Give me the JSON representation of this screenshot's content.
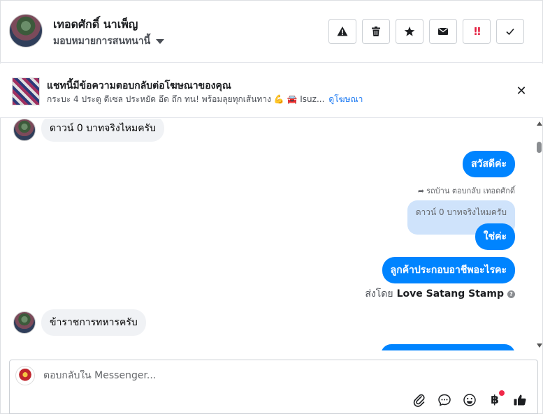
{
  "header": {
    "user_name": "เทอดศักดิ์ นาเพ็ญ",
    "assign_label": "มอบหมายการสนทนานี้"
  },
  "ad_banner": {
    "title": "แชทนี้มีข้อความตอบกลับต่อโฆษณาของคุณ",
    "subtitle": "กระบะ 4 ประตู ดีเซล ประหยัด อึด ถึก ทน! พร้อมลุยทุกเส้นทาง 💪 🚘 Isuz...",
    "link": "ดูโฆษณา"
  },
  "messages": {
    "m1": "ดาวน์ 0 บาทจริงไหมครับ",
    "m2": "สวัสดีค่ะ",
    "reply_meta": "รถบ้าน ตอบกลับ เทอดศักดิ์",
    "quoted": "ดาวน์ 0 บาทจริงไหมครับ",
    "m3": "ใช่ค่ะ",
    "m4": "ลูกค้าประกอบอาชีพอะไรคะ",
    "sent_by_prefix": "ส่งโดย",
    "sent_by_name": "Love Satang Stamp",
    "m5": "ข้าราชการทหารครับ"
  },
  "composer": {
    "placeholder": "ตอบกลับใน Messenger..."
  },
  "colors": {
    "outgoing_bubble": "#0084ff",
    "incoming_bubble": "#f0f2f5",
    "quote_bubble": "#cfe3fb",
    "link": "#1877f2"
  }
}
